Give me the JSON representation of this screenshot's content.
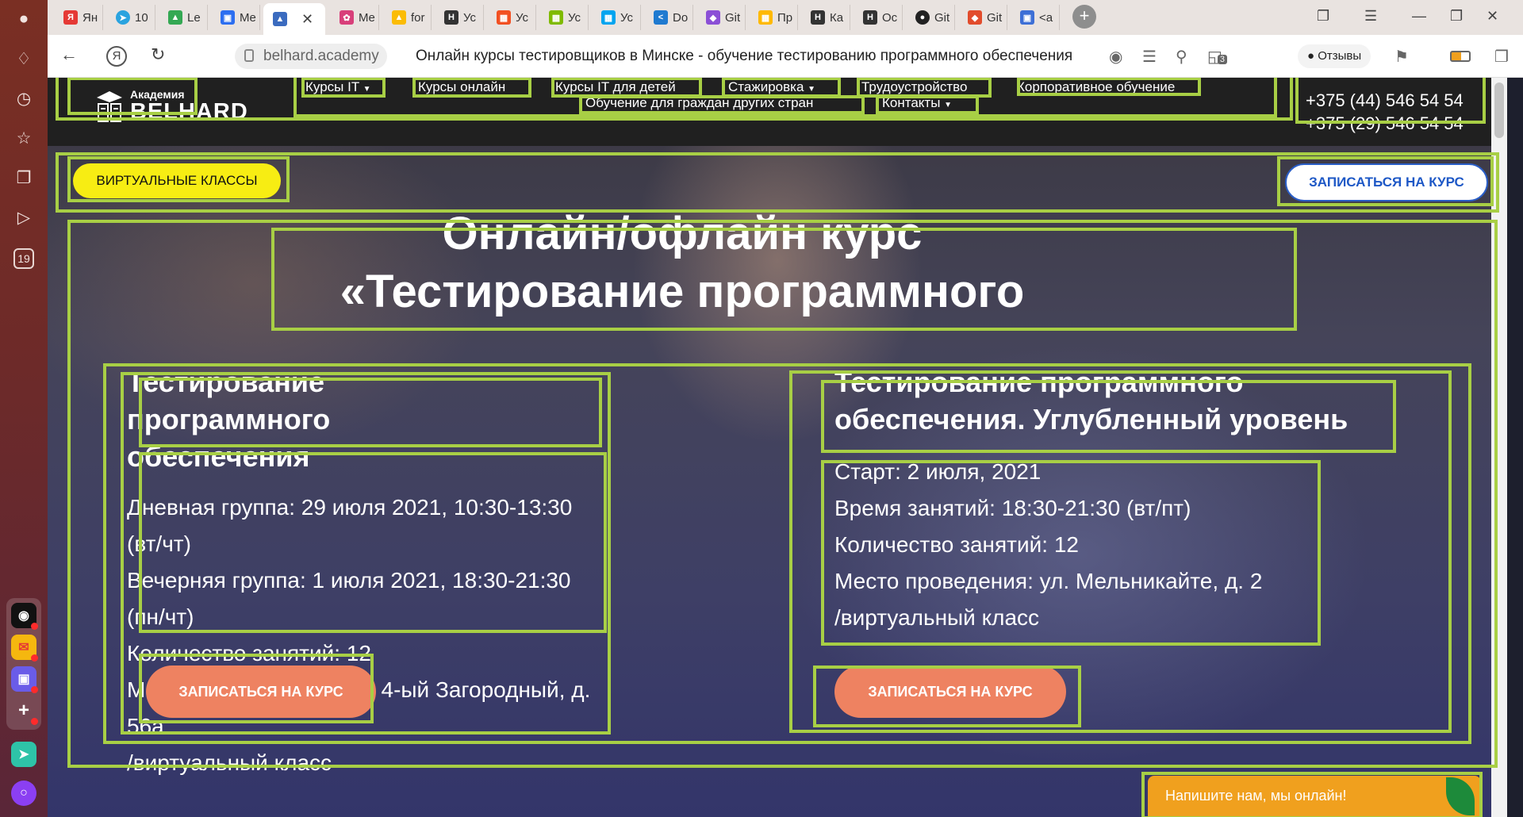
{
  "browser": {
    "tabs": [
      {
        "label": "Ян",
        "icon": "yandex-icon",
        "color": "#e53935"
      },
      {
        "label": "10",
        "icon": "telegram-icon",
        "color": "#2aa3df"
      },
      {
        "label": "Le",
        "icon": "google-drive-icon",
        "color": "#34a853"
      },
      {
        "label": "Me",
        "icon": "chat-icon",
        "color": "#2c6ef0"
      },
      {
        "label": "",
        "icon": "academy-cap-icon",
        "color": "#3b6bbf"
      },
      {
        "label": "Me",
        "icon": "pinwheel-icon",
        "color": "#d83f7a"
      },
      {
        "label": "for",
        "icon": "google-drive-icon",
        "color": "#fbbc05"
      },
      {
        "label": "Ус",
        "icon": "site-h-icon",
        "color": "#333333"
      },
      {
        "label": "Ус",
        "icon": "microsoft-icon",
        "color": "#f25022"
      },
      {
        "label": "Ус",
        "icon": "microsoft-icon",
        "color": "#7fba00"
      },
      {
        "label": "Ус",
        "icon": "microsoft-icon",
        "color": "#00a4ef"
      },
      {
        "label": "Do",
        "icon": "vscode-icon",
        "color": "#1f7ad0"
      },
      {
        "label": "Git",
        "icon": "diamond-icon",
        "color": "#8b4fd6"
      },
      {
        "label": "Пр",
        "icon": "microsoft-icon",
        "color": "#ffb900"
      },
      {
        "label": "Ка",
        "icon": "site-h-icon",
        "color": "#333333"
      },
      {
        "label": "Ос",
        "icon": "site-h-icon",
        "color": "#333333"
      },
      {
        "label": "Git",
        "icon": "github-icon",
        "color": "#222222"
      },
      {
        "label": "Git",
        "icon": "git-icon",
        "color": "#e24c2c"
      },
      {
        "label": "<a",
        "icon": "chat-icon",
        "color": "#3d6fd6"
      }
    ],
    "url": "belhard.academy",
    "page_title": "Онлайн курсы тестировщиков в Минске - обучение тестированию программного обеспечения",
    "reviews_label": "Отзывы",
    "tab_counter": "3",
    "sidebar_badge": "19"
  },
  "site": {
    "logo": {
      "top": "Академия",
      "main": "BELHARD"
    },
    "menu": [
      "Курсы IT",
      "Курсы онлайн",
      "Курсы IT для детей",
      "Стажировка",
      "Трудоустройство",
      "Корпоративное обучение",
      "Обучение для граждан других стран",
      "Контакты"
    ],
    "phones": [
      "+375 (44) 546 54 54",
      "+375 (29) 546 54 54"
    ],
    "virtual_button": "ВИРТУАЛЬНЫЕ КЛАССЫ",
    "signup_button": "ЗАПИСАТЬСЯ НА КУРС",
    "hero_title": "Онлайн/офлайн курс «Тестирование программного обеспечения»",
    "cards": [
      {
        "title": "Тестирование программного обеспечения",
        "lines": [
          "Дневная группа: 29 июля 2021, 10:30-13:30 (вт/чт)",
          "Вечерняя группа: 1 июля 2021, 18:30-21:30 (пн/чт)",
          "Количество занятий: 12",
          "Место проведения: пер. 4-ый Загородный, д. 56а",
          "/виртуальный класс"
        ],
        "button": "ЗАПИСАТЬСЯ НА КУРС"
      },
      {
        "title": "Тестирование программного обеспечения. Углубленный уровень",
        "lines": [
          "Старт: 2 июля, 2021",
          "Время занятий: 18:30-21:30 (вт/пт)",
          "Количество занятий: 12",
          "Место проведения: ул. Мельникайте, д. 2",
          "/виртуальный класс"
        ],
        "button": "ЗАПИСАТЬСЯ НА КУРС"
      }
    ],
    "chat_widget": "Напишите нам, мы онлайн!"
  },
  "colors": {
    "highlight": "#a8cf45",
    "accent_yellow": "#f7ed13",
    "cta_orange": "#ee8261",
    "chat_orange": "#f0a01e",
    "header_bg": "#202020"
  }
}
